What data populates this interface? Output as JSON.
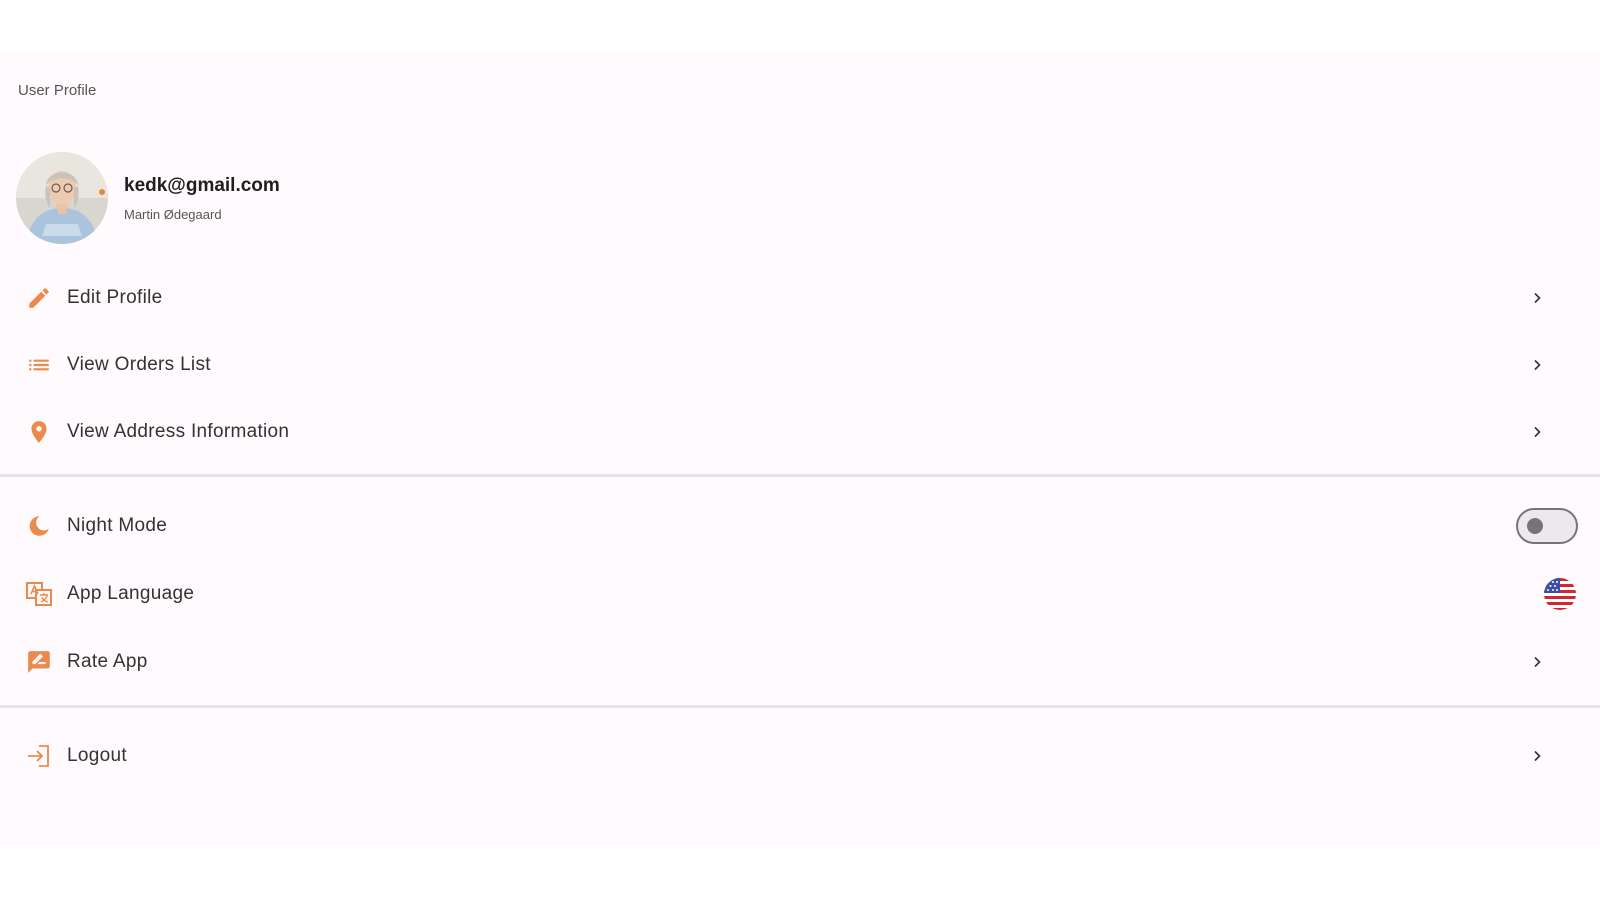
{
  "header": {
    "title": "User Profile"
  },
  "profile": {
    "email": "kedk@gmail.com",
    "name": "Martin Ødegaard"
  },
  "menu_account": [
    {
      "label": "Edit Profile",
      "icon": "pencil-icon"
    },
    {
      "label": "View Orders List",
      "icon": "list-icon"
    },
    {
      "label": "View Address Information",
      "icon": "location-pin-icon"
    }
  ],
  "menu_settings": [
    {
      "label": "Night Mode",
      "icon": "moon-icon",
      "control": "toggle",
      "enabled": false
    },
    {
      "label": "App Language",
      "icon": "translate-icon",
      "control": "us-flag-icon"
    },
    {
      "label": "Rate App",
      "icon": "rate-review-icon"
    }
  ],
  "menu_session": [
    {
      "label": "Logout",
      "icon": "logout-icon"
    }
  ],
  "colors": {
    "accent": "#ec8a4c",
    "background": "#fefafd",
    "divider": "#e7e4e8"
  }
}
